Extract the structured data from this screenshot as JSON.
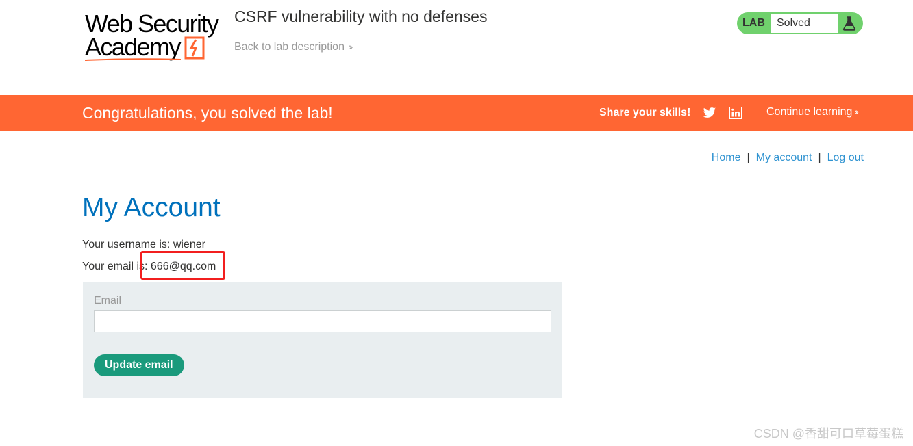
{
  "header": {
    "logo_line1": "Web Security",
    "logo_line2": "Academy",
    "lab_title": "CSRF vulnerability with no defenses",
    "back_link": "Back to lab description",
    "lab_badge_label": "LAB",
    "lab_badge_status": "Solved",
    "lab_badge_icon": "flask-icon"
  },
  "banner": {
    "message": "Congratulations, you solved the lab!",
    "share_label": "Share your skills!",
    "continue_label": "Continue learning",
    "background_color": "#ff6633"
  },
  "nav": {
    "items": [
      "Home",
      "My account",
      "Log out"
    ],
    "separator": "|"
  },
  "main": {
    "title": "My Account",
    "username_line": "Your username is: wiener",
    "email_line": "Your email is: 666@qq.com"
  },
  "form": {
    "email_label": "Email",
    "email_value": "",
    "submit_label": "Update email"
  },
  "watermark": "CSDN @香甜可口草莓蛋糕",
  "colors": {
    "accent": "#ff6633",
    "link": "#2f93d1",
    "title": "#0071bc",
    "button": "#1a9a7c",
    "solved": "#70d16d",
    "highlight": "#f21f1f"
  }
}
